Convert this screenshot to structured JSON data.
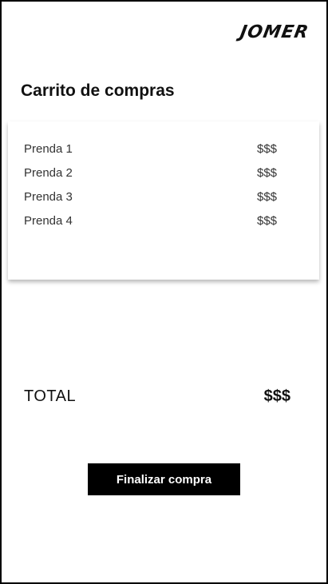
{
  "header": {
    "brand": "JOMER"
  },
  "cart": {
    "title": "Carrito de compras",
    "items": [
      {
        "name": "Prenda 1",
        "price": "$$$"
      },
      {
        "name": "Prenda 2",
        "price": "$$$"
      },
      {
        "name": "Prenda 3",
        "price": "$$$"
      },
      {
        "name": "Prenda 4",
        "price": "$$$"
      }
    ]
  },
  "summary": {
    "total_label": "TOTAL",
    "total_value": "$$$"
  },
  "actions": {
    "checkout_label": "Finalizar compra"
  },
  "colors": {
    "primary": "#000000",
    "background": "#ffffff"
  }
}
